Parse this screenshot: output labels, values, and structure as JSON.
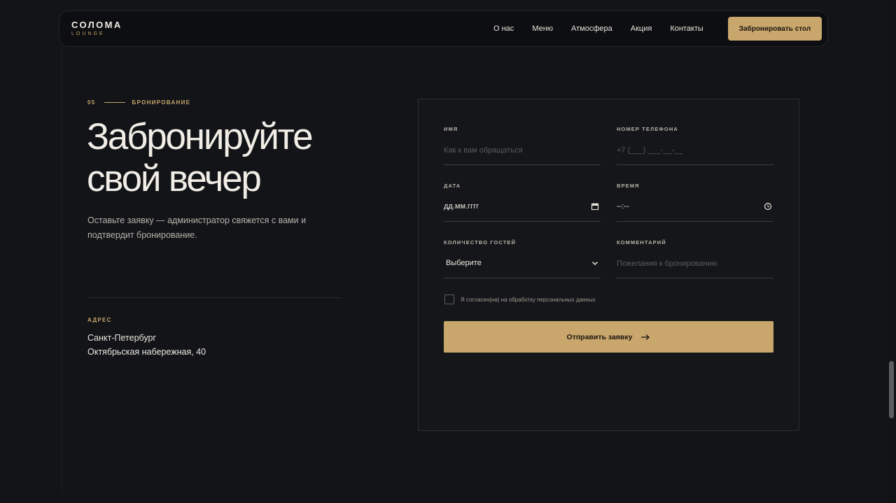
{
  "brand": {
    "name": "СОЛОМА",
    "subtitle": "LOUNGE"
  },
  "nav": {
    "links": [
      {
        "label": "О нас"
      },
      {
        "label": "Меню"
      },
      {
        "label": "Атмосфера"
      },
      {
        "label": "Акция"
      },
      {
        "label": "Контакты"
      }
    ],
    "cta_label": "Забронировать стол"
  },
  "section": {
    "number": "05",
    "eyebrow": "БРОНИРОВАНИЕ",
    "title": "Забронируйте свой вечер",
    "intro": "Оставьте заявку — администратор свяжется с вами и подтвердит бронирование.",
    "address_label": "АДРЕС",
    "address_city": "Санкт-Петербург",
    "address_street": "Октябрьская набережная, 40"
  },
  "form": {
    "name": {
      "label": "Имя",
      "placeholder": "Как к вам обращаться"
    },
    "phone": {
      "label": "Номер телефона",
      "placeholder": "+7 (___) ___-__-__"
    },
    "date": {
      "label": "Дата",
      "value": "дд.мм.гггг",
      "icon": "calendar-icon"
    },
    "time": {
      "label": "Время",
      "value": "--:--",
      "icon": "clock-icon"
    },
    "guests": {
      "label": "Количество гостей",
      "value": "Выберите",
      "icon": "chevron-down-icon"
    },
    "comment": {
      "label": "Комментарий",
      "placeholder": "Пожелания к бронированию"
    },
    "consent_text": "Я согласен(на) на обработку персональных данных",
    "submit_label": "Отправить заявку",
    "submit_icon": "arrow-right-icon"
  },
  "colors": {
    "accent": "#c9a66b",
    "background": "#121418",
    "panel": "#141619",
    "text": "#f1ede6"
  }
}
